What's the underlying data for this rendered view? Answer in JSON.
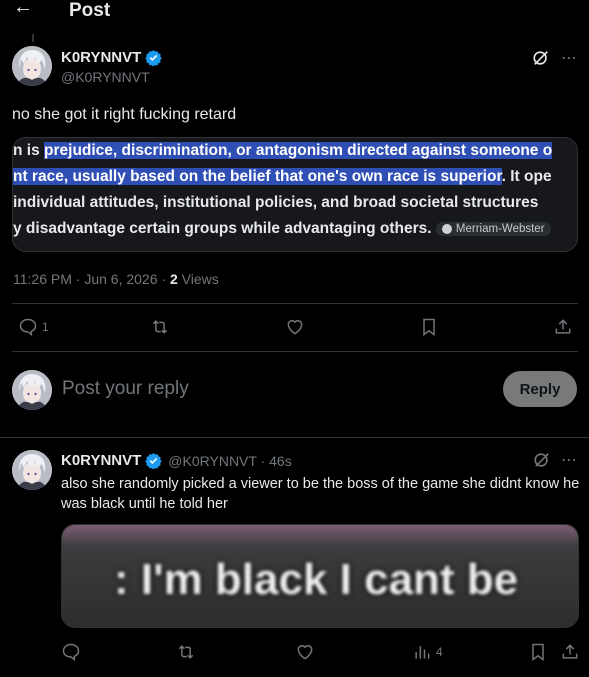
{
  "header": {
    "back_icon": "arrow-left-icon",
    "title": "Post"
  },
  "post": {
    "author_name": "K0RYNNVT",
    "author_handle": "@K0RYNNVT",
    "text": "no she got it right fucking retard",
    "definition": {
      "line1_plain": "n is ",
      "line1_hl": "prejudice, discrimination, or antagonism directed against someone o",
      "line2_hl": "nt race, usually based on the belief that one's own race is superior",
      "line2_plain": ". It ope",
      "line3": " individual attitudes, institutional policies, and broad societal structures",
      "line4": "y disadvantage certain groups while advantaging others.",
      "source": "Merriam-Webster"
    },
    "time": "11:26 PM · Jun 6, 2026 · ",
    "views_count": "2",
    "views_label": " Views",
    "reply_count": "1"
  },
  "reply_box": {
    "placeholder": "Post your reply",
    "button": "Reply"
  },
  "reply2": {
    "author_name": "K0RYNNVT",
    "author_handle": "@K0RYNNVT · 46s",
    "text": "also she randomly picked a viewer to be the boss of the game she didnt know he was black until he told her",
    "video_caption": ": I'm black I cant be",
    "views_count": "4"
  },
  "colors": {
    "verified": "#1d9bf0",
    "highlight": "#2f4fb5",
    "muted": "#71767b"
  }
}
